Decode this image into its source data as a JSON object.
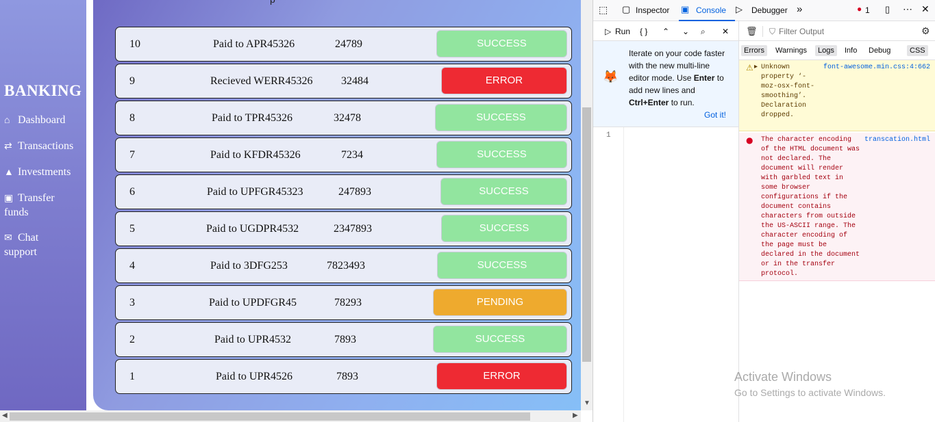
{
  "sidebar": {
    "brand": "BANKING",
    "items": [
      {
        "label": "Dashboard",
        "icon": "⌂"
      },
      {
        "label": "Transactions",
        "icon": "⇄"
      },
      {
        "label": "Investments",
        "icon": "▲"
      },
      {
        "label": "Transfer funds",
        "icon": "▣"
      },
      {
        "label": "Chat support",
        "icon": "✉"
      }
    ]
  },
  "main": {
    "top_text": "p",
    "transactions": [
      {
        "id": "10",
        "desc": "Paid to APR45326",
        "amount": "24789",
        "status": "SUCCESS"
      },
      {
        "id": "9",
        "desc": "Recieved WERR45326",
        "amount": "32484",
        "status": "ERROR"
      },
      {
        "id": "8",
        "desc": "Paid to TPR45326",
        "amount": "32478",
        "status": "SUCCESS"
      },
      {
        "id": "7",
        "desc": "Paid to KFDR45326",
        "amount": "7234",
        "status": "SUCCESS"
      },
      {
        "id": "6",
        "desc": "Paid to UPFGR45323",
        "amount": "247893",
        "status": "SUCCESS"
      },
      {
        "id": "5",
        "desc": "Paid to UGDPR4532",
        "amount": "2347893",
        "status": "SUCCESS"
      },
      {
        "id": "4",
        "desc": "Paid to 3DFG253",
        "amount": "7823493",
        "status": "SUCCESS"
      },
      {
        "id": "3",
        "desc": "Paid to UPDFGR45",
        "amount": "78293",
        "status": "PENDING"
      },
      {
        "id": "2",
        "desc": "Paid to UPR4532",
        "amount": "7893",
        "status": "SUCCESS"
      },
      {
        "id": "1",
        "desc": "Paid to UPR4526",
        "amount": "7893",
        "status": "ERROR"
      }
    ],
    "status_colors": {
      "SUCCESS": "#92e59f",
      "ERROR": "#ee2a33",
      "PENDING": "#eeaa2e"
    }
  },
  "devtools": {
    "tabs": {
      "inspector": "Inspector",
      "console": "Console",
      "debugger": "Debugger"
    },
    "error_count": "1",
    "editor": {
      "run": "Run",
      "format": "{ }"
    },
    "notice": {
      "text_a": "Iterate on your code faster with the new multi-line editor mode. Use ",
      "enter": "Enter",
      "text_b": " to add new lines and ",
      "ctrl_enter": "Ctrl+Enter",
      "text_c": " to run.",
      "got_it": "Got it!"
    },
    "line_number": "1",
    "filter_placeholder": "Filter Output",
    "filters": [
      "Errors",
      "Warnings",
      "Logs",
      "Info",
      "Debug",
      "CSS"
    ],
    "messages": {
      "warning": {
        "text": "Unknown property ‘-moz-osx-font-smoothing’. Declaration dropped.",
        "source": "font-awesome.min.css:4:662"
      },
      "error": {
        "text": "The character encoding of the HTML document was not declared. The document will render with garbled text in some browser configurations if the document contains characters from outside the US-ASCII range. The character encoding of the page must be declared in the document or in the transfer protocol.",
        "source": "transcation.html"
      }
    }
  },
  "watermark": {
    "title": "Activate Windows",
    "subtitle": "Go to Settings to activate Windows."
  }
}
